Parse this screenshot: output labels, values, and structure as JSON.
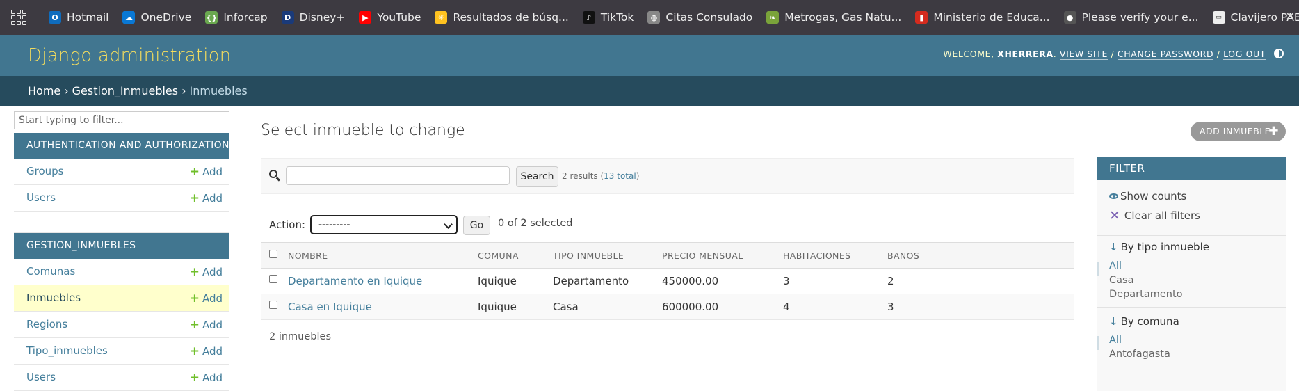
{
  "bookmarks": [
    {
      "label": "Hotmail",
      "icon": "outlook-icon",
      "color": "#0f6cbd",
      "glyph": "O"
    },
    {
      "label": "OneDrive",
      "icon": "onedrive-icon",
      "color": "#0a78d4",
      "glyph": "☁"
    },
    {
      "label": "Inforcap",
      "icon": "inforcap-icon",
      "color": "#6aa84f",
      "glyph": "{}"
    },
    {
      "label": "Disney+",
      "icon": "disney-icon",
      "color": "#1a3a7a",
      "glyph": "D"
    },
    {
      "label": "YouTube",
      "icon": "youtube-icon",
      "color": "#ff0000",
      "glyph": "▶"
    },
    {
      "label": "Resultados de búsq...",
      "icon": "walmart-icon",
      "color": "#ffc220",
      "glyph": "✳"
    },
    {
      "label": "TikTok",
      "icon": "tiktok-icon",
      "color": "#111111",
      "glyph": "♪"
    },
    {
      "label": "Citas Consulado",
      "icon": "globe-icon",
      "color": "#888888",
      "glyph": "◍"
    },
    {
      "label": "Metrogas, Gas Natu...",
      "icon": "metrogas-icon",
      "color": "#7aa33a",
      "glyph": "❧"
    },
    {
      "label": "Ministerio de Educa...",
      "icon": "mineduc-icon",
      "color": "#d52b1e",
      "glyph": "▮"
    },
    {
      "label": "Please verify your e...",
      "icon": "github-icon",
      "color": "#555555",
      "glyph": "●"
    },
    {
      "label": "Clavijero PAES",
      "icon": "demre-icon",
      "color": "#eeeeee",
      "glyph": "▭"
    }
  ],
  "header": {
    "brand": "Django administration",
    "welcome": "WELCOME,",
    "username": "XHERRERA",
    "view_site": "VIEW SITE",
    "change_password": "CHANGE PASSWORD",
    "log_out": "LOG OUT",
    "sep": "/"
  },
  "breadcrumbs": {
    "home": "Home",
    "app": "Gestion_Inmuebles",
    "current": "Inmuebles",
    "sep": "›"
  },
  "sidebar": {
    "filter_placeholder": "Start typing to filter...",
    "add_label": "Add",
    "modules": [
      {
        "caption": "AUTHENTICATION AND AUTHORIZATION",
        "items": [
          "Groups",
          "Users"
        ]
      },
      {
        "caption": "GESTION_INMUEBLES",
        "items": [
          "Comunas",
          "Inmuebles",
          "Regions",
          "Tipo_inmuebles",
          "Users"
        ]
      }
    ]
  },
  "content": {
    "title": "Select inmueble to change",
    "add_button": "ADD INMUEBLE",
    "search_button": "Search",
    "search_value": "",
    "results_text": "2 results (",
    "total_link": "13 total",
    "results_close": ")",
    "action_label": "Action:",
    "action_selected": "---------",
    "go_button": "Go",
    "selected_count": "0 of 2 selected",
    "columns": [
      "NOMBRE",
      "COMUNA",
      "TIPO INMUEBLE",
      "PRECIO MENSUAL",
      "HABITACIONES",
      "BANOS"
    ],
    "rows": [
      {
        "nombre": "Departamento en Iquique",
        "comuna": "Iquique",
        "tipo": "Departamento",
        "precio": "450000.00",
        "habitaciones": "3",
        "banos": "2"
      },
      {
        "nombre": "Casa en Iquique",
        "comuna": "Iquique",
        "tipo": "Casa",
        "precio": "600000.00",
        "habitaciones": "4",
        "banos": "3"
      }
    ],
    "paginator": "2 inmuebles"
  },
  "filter": {
    "title": "FILTER",
    "show_counts": "Show counts",
    "clear_all": "Clear all filters",
    "groups": [
      {
        "title": "By tipo inmueble",
        "options": [
          "All",
          "Casa",
          "Departamento"
        ]
      },
      {
        "title": "By comuna",
        "options": [
          "All",
          "Antofagasta"
        ]
      }
    ]
  },
  "colors": {
    "header": "#417690",
    "breadcrumbs": "#264b5d",
    "brand": "#f5dd5d",
    "link": "#447e9b",
    "add_green": "#70bf2b",
    "selected_row": "#ffffcc"
  }
}
